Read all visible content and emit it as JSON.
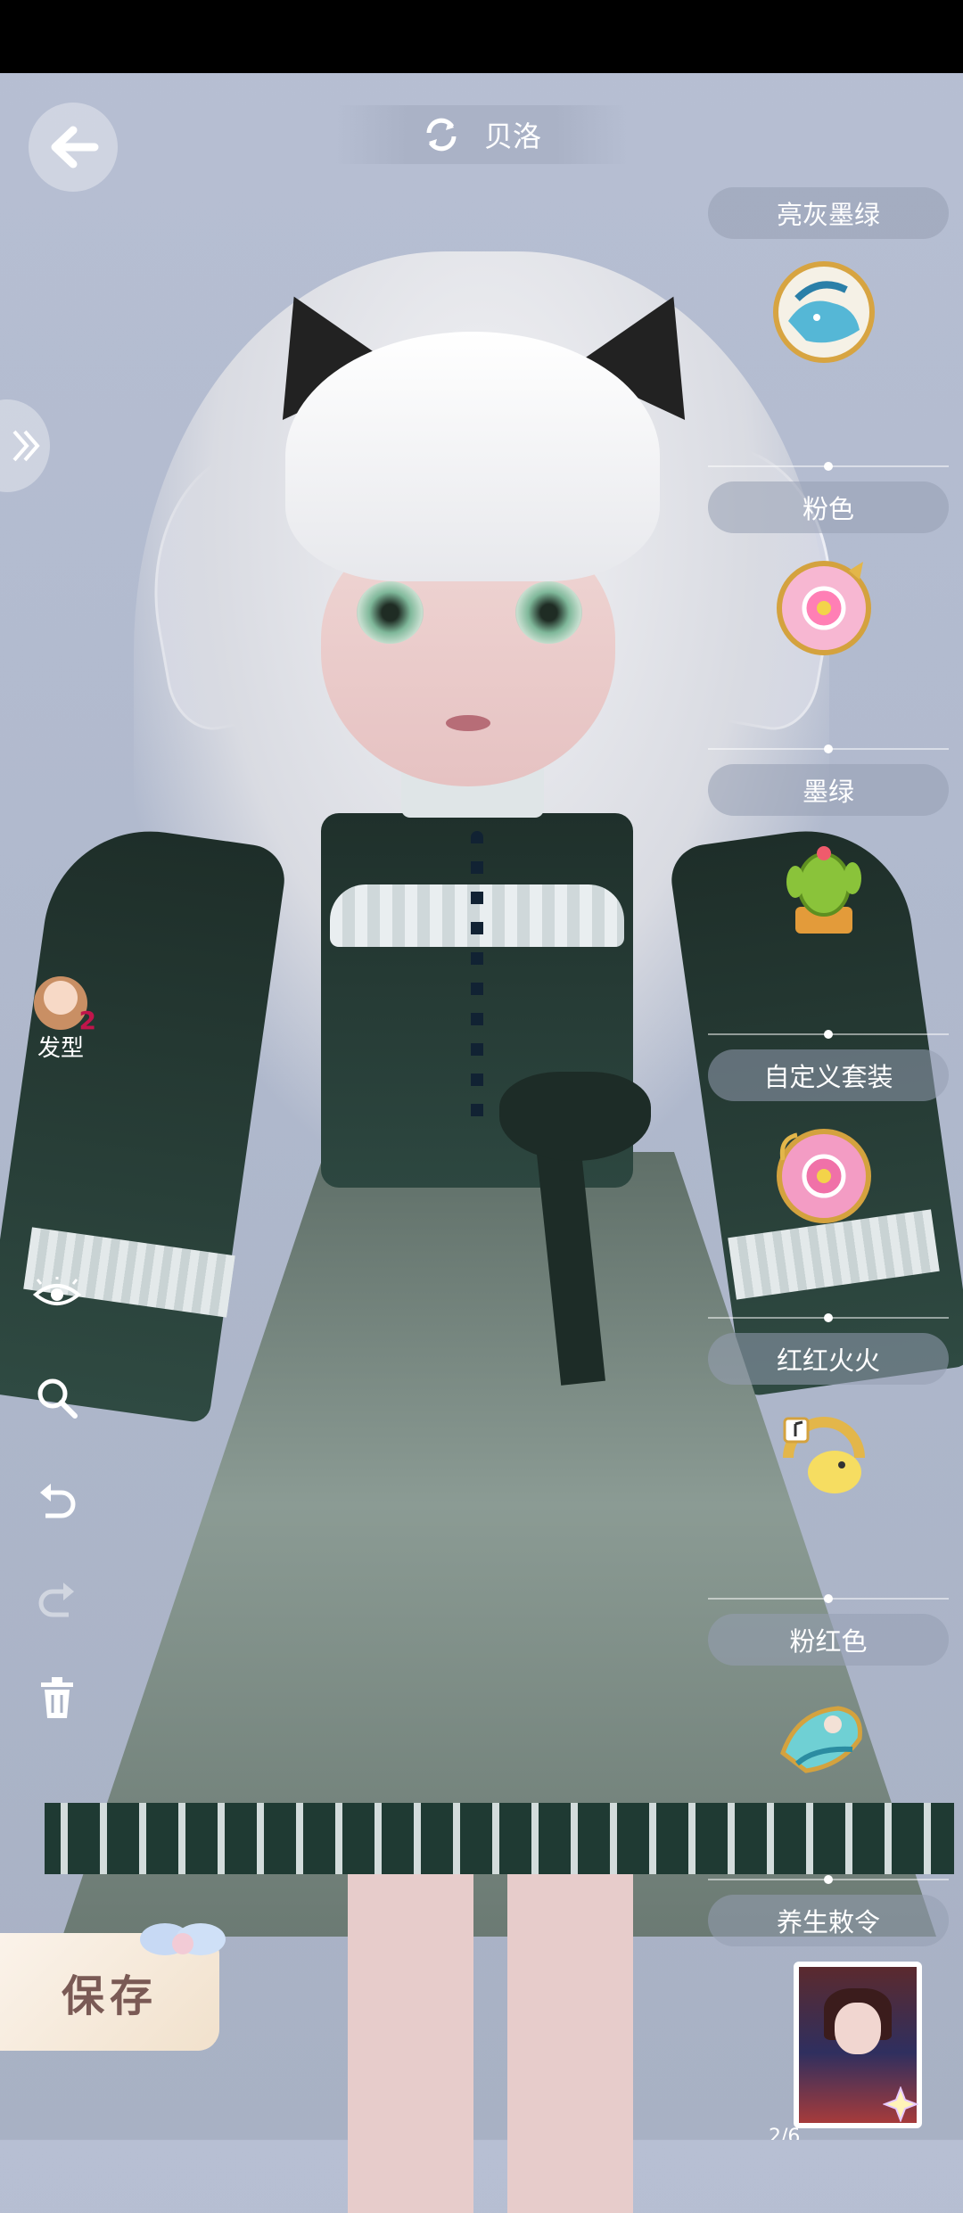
{
  "header": {
    "character_name": "贝洛"
  },
  "left_panel": {
    "hairstyle": {
      "label": "发型",
      "count": "2"
    }
  },
  "outfits": [
    {
      "label": "亮灰墨绿",
      "icon": "whale-badge-icon"
    },
    {
      "label": "粉色",
      "icon": "pink-flower-watch-icon"
    },
    {
      "label": "墨绿",
      "icon": "cactus-pot-icon"
    },
    {
      "label": "自定义套装",
      "icon": "flower-pocket-watch-icon"
    },
    {
      "label": "红红火火",
      "icon": "music-chick-badge-icon"
    },
    {
      "label": "粉红色",
      "icon": "mermaid-badge-icon"
    },
    {
      "label": "养生敕令",
      "icon": "character-portrait-card"
    }
  ],
  "save": {
    "label": "保存"
  },
  "pager": {
    "text": "2/6"
  },
  "colors": {
    "accent": "#c0154b",
    "dress": "#2d4740",
    "label_bg": "#969eb2"
  }
}
